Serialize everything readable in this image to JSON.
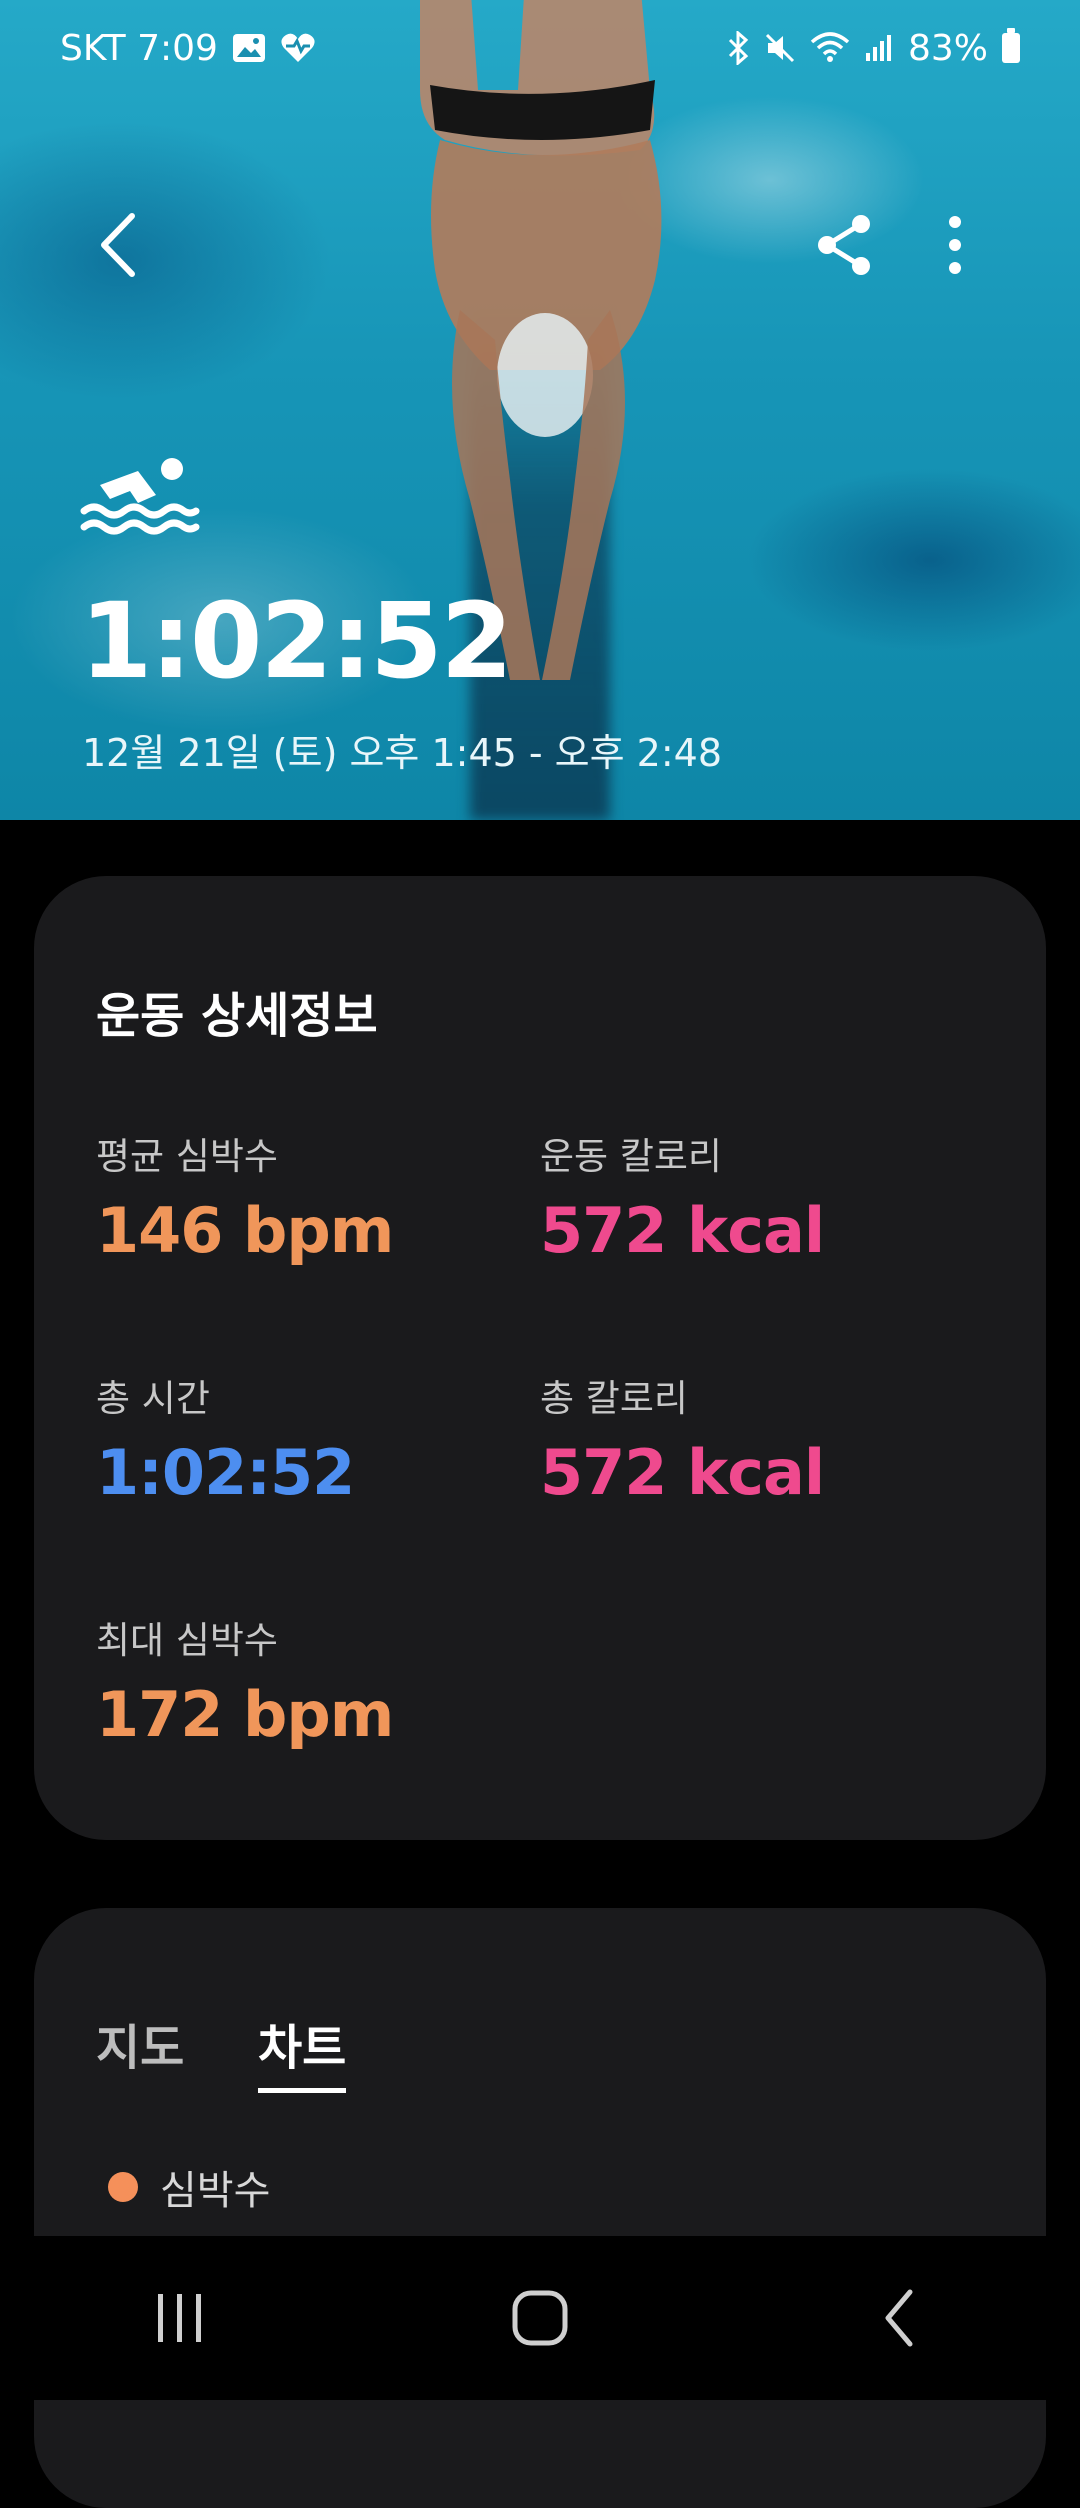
{
  "status_bar": {
    "carrier_time": "SKT 7:09",
    "battery": "83%",
    "icons": [
      "gallery-icon",
      "health-icon",
      "bluetooth-icon",
      "mute-icon",
      "wifi-icon",
      "signal-icon",
      "battery-icon"
    ]
  },
  "hero": {
    "activity_icon": "swimming-icon",
    "duration": "1:02:52",
    "time_range": "12월 21일 (토) 오후 1:45 - 오후 2:48"
  },
  "details": {
    "title": "운동 상세정보",
    "stats": [
      {
        "label": "평균 심박수",
        "value": "146 bpm",
        "color": "#f0965a"
      },
      {
        "label": "운동 칼로리",
        "value": "572 kcal",
        "color": "#ef4a8e"
      },
      {
        "label": "총 시간",
        "value": "1:02:52",
        "color": "#4d8ef0"
      },
      {
        "label": "총 칼로리",
        "value": "572 kcal",
        "color": "#ef4a8e"
      },
      {
        "label": "최대 심박수",
        "value": "172 bpm",
        "color": "#f0965a"
      }
    ]
  },
  "charts_card": {
    "tabs": [
      {
        "label": "지도",
        "selected": false
      },
      {
        "label": "차트",
        "selected": true
      }
    ],
    "legend": {
      "label": "심박수",
      "color": "#f5905a"
    }
  },
  "nav": {
    "buttons": [
      "recent-apps-icon",
      "home-icon",
      "back-icon"
    ]
  }
}
